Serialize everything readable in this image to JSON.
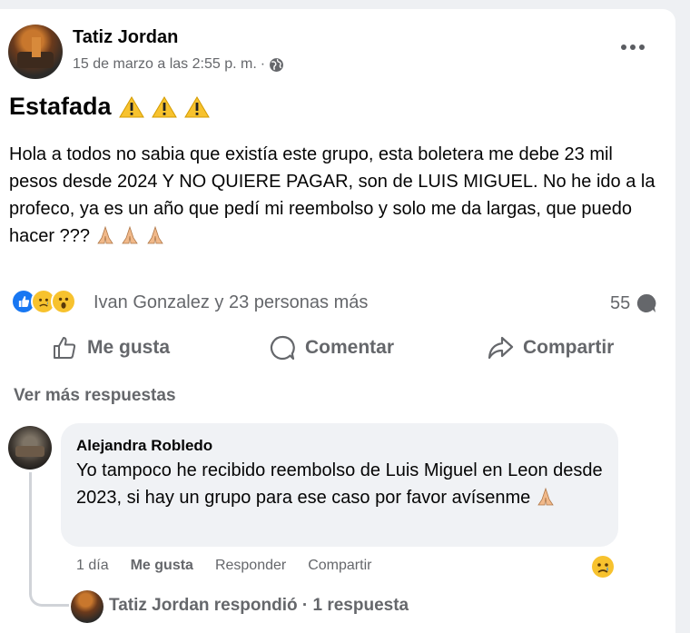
{
  "post": {
    "author": "Tatiz Jordan",
    "timestamp": "15 de marzo a las 2:55 p. m.",
    "separator": "·",
    "privacy_icon": "globe-icon",
    "title": "Estafada",
    "title_emoji": "warning-icon",
    "body": "Hola a todos no sabia que existía este grupo, esta boletera me debe 23 mil pesos desde 2024 Y NO QUIERE PAGAR, son de LUIS MIGUEL. No he ido a la profeco, ya es un año que pedí mi reembolso y solo me da largas, que puedo hacer ???",
    "body_emoji": "folded-hands-icon"
  },
  "reactions": {
    "types": [
      "like",
      "sad",
      "wow"
    ],
    "summary": "Ivan Gonzalez y 23 personas más",
    "comment_count": "55"
  },
  "actions": {
    "like": "Me gusta",
    "comment": "Comentar",
    "share": "Compartir"
  },
  "comments": {
    "see_more": "Ver más respuestas",
    "first": {
      "author": "Alejandra Robledo",
      "text": "Yo tampoco he recibido reembolso de Luis Miguel en Leon desde 2023, si hay un grupo para ese caso por favor avísenme",
      "time": "1 día",
      "like": "Me gusta",
      "reply": "Responder",
      "share": "Compartir",
      "reaction": "sad-face-icon"
    },
    "reply_summary": "Tatiz Jordan respondió · 1 respuesta"
  },
  "colors": {
    "text_primary": "#050505",
    "text_secondary": "#65676b",
    "like_blue": "#1877f2",
    "bubble_bg": "#f0f2f5",
    "page_bg": "#eef0f3"
  }
}
